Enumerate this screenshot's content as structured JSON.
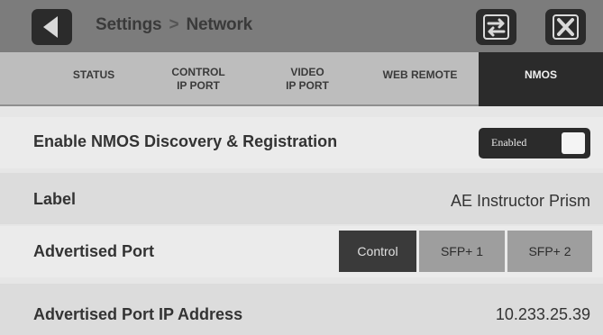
{
  "header": {
    "breadcrumb_parent": "Settings",
    "breadcrumb_separator": ">",
    "breadcrumb_current": "Network",
    "icons": {
      "back": "back-arrow-icon",
      "swap": "swap-arrows-icon",
      "close": "close-x-icon"
    }
  },
  "tabs": [
    {
      "line1": "STATUS",
      "line2": ""
    },
    {
      "line1": "CONTROL",
      "line2": "IP PORT"
    },
    {
      "line1": "VIDEO",
      "line2": "IP PORT"
    },
    {
      "line1": "WEB REMOTE",
      "line2": ""
    },
    {
      "line1": "NMOS",
      "line2": "",
      "active": true
    }
  ],
  "settings": {
    "nmos_discovery": {
      "label": "Enable NMOS Discovery & Registration",
      "toggle_text": "Enabled",
      "enabled": true
    },
    "label": {
      "label": "Label",
      "value": "AE Instructor Prism"
    },
    "advertised_port": {
      "label": "Advertised Port",
      "options": [
        "Control",
        "SFP+ 1",
        "SFP+ 2"
      ],
      "selected": "Control"
    },
    "advertised_ip": {
      "label": "Advertised Port IP Address",
      "value": "10.233.25.39"
    }
  },
  "colors": {
    "header_bg": "#7c7c7c",
    "tab_bg": "#bdbdbd",
    "active_tab": "#2b2b2b",
    "button_dark": "#2b2b2b"
  }
}
